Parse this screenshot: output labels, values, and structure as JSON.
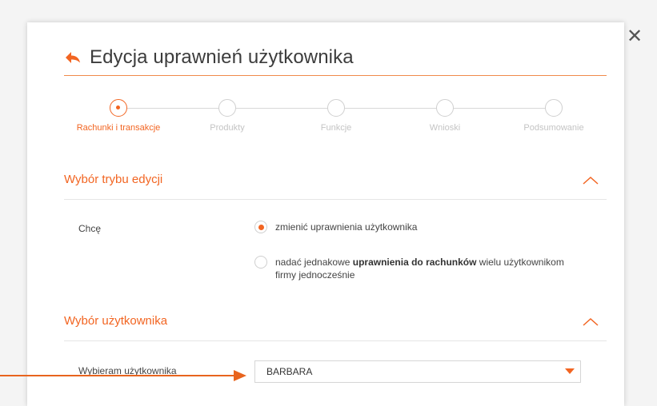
{
  "dialog": {
    "title": "Edycja uprawnień użytkownika",
    "close_label": "✕"
  },
  "stepper": {
    "steps": [
      {
        "label": "Rachunki i transakcje",
        "active": true
      },
      {
        "label": "Produkty",
        "active": false
      },
      {
        "label": "Funkcje",
        "active": false
      },
      {
        "label": "Wnioski",
        "active": false
      },
      {
        "label": "Podsumowanie",
        "active": false
      }
    ]
  },
  "section_mode": {
    "title": "Wybór trybu edycji",
    "field_label": "Chcę",
    "options": [
      {
        "text": "zmienić uprawnienia użytkownika",
        "checked": true
      },
      {
        "text_before": "nadać jednakowe ",
        "text_bold": "uprawnienia do rachunków",
        "text_after": " wielu użytkownikom firmy jednocześnie",
        "checked": false
      }
    ]
  },
  "section_user": {
    "title": "Wybór użytkownika",
    "field_label": "Wybieram użytkownika",
    "selected_value": "BARBARA"
  },
  "colors": {
    "accent": "#f26522",
    "annotation_arrow": "#e8641e",
    "text": "#444444",
    "inactive_step": "#c4c4c4"
  },
  "icons": {
    "back": "back-arrow-icon",
    "close": "close-icon",
    "collapse": "chevron-up-icon",
    "dropdown": "caret-down-icon"
  }
}
